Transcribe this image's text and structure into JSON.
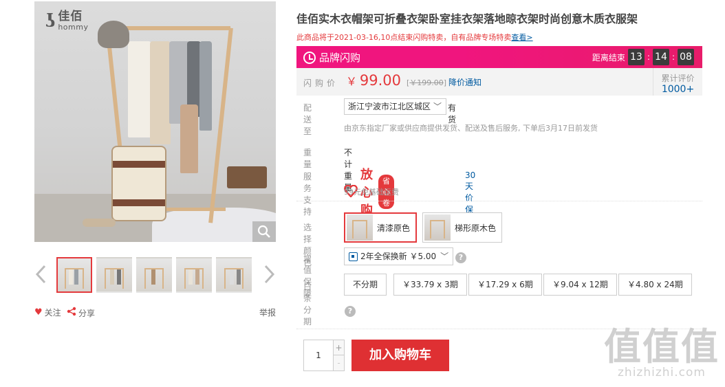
{
  "gallery": {
    "logo_mark": "ʖ",
    "logo_cn": "佳佰",
    "logo_en": "hommy",
    "zoom_icon": "magnifier-icon",
    "thumbnails_count": 5,
    "prev_icon": "chevron-left-icon",
    "next_icon": "chevron-right-icon"
  },
  "actions": {
    "follow": "关注",
    "share": "分享",
    "report": "举报"
  },
  "product": {
    "title": "佳佰实木衣帽架可折叠衣架卧室挂衣架落地晾衣架时尚创意木质衣服架",
    "notice": "此商品将于2021-03-16,10点结束闪购特卖，自有品牌专场特卖",
    "notice_link": "查看>"
  },
  "flash": {
    "label": "品牌闪购",
    "countdown_label": "距离结束",
    "hours": "13",
    "minutes": "14",
    "seconds": "08",
    "sep": ":"
  },
  "price": {
    "label": "闪购价",
    "currency": "￥",
    "value": "99.00",
    "original": "￥199.00",
    "drop_notify": "降价通知",
    "review_label": "累计评价",
    "review_count": "1000+"
  },
  "delivery": {
    "label": "配送至",
    "address": "浙江宁波市江北区城区",
    "stock": "有货",
    "note": "由京东指定厂家或供应商提供发货、配送及售后服务, 下单后3月17日前发货"
  },
  "weight": {
    "label": "重量",
    "value": "不计重量"
  },
  "service": {
    "label": "服务支持",
    "logo": "放心购",
    "badge": "省心卷",
    "extra": "30天价保",
    "freeship": "99元免基础运费"
  },
  "color": {
    "label": "选择颜色",
    "options": [
      "清漆原色",
      "梯形原木色"
    ]
  },
  "vas": {
    "label": "增值保障",
    "value": "2年全保换新 ￥5.00"
  },
  "installment": {
    "label": "白条分期",
    "options": [
      "不分期",
      "￥33.79 x 3期",
      "￥17.29 x 6期",
      "￥9.04 x 12期",
      "￥4.80 x 24期"
    ]
  },
  "cart": {
    "qty": "1",
    "plus": "+",
    "minus": "-",
    "button": "加入购物车"
  },
  "watermark": {
    "big": "值值值",
    "small": "zhizhizhi.com"
  }
}
